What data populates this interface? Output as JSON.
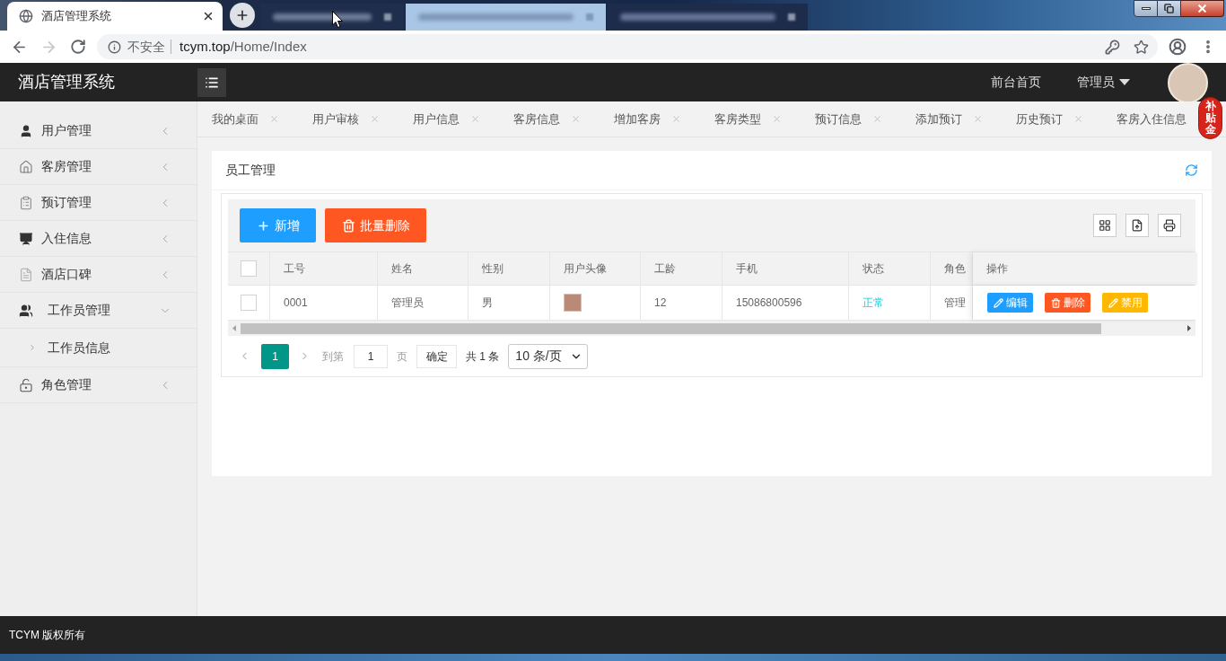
{
  "browser": {
    "tab_title": "酒店管理系统",
    "security_label": "不安全",
    "url_host": "tcym.top",
    "url_path": "/Home/Index"
  },
  "header": {
    "title": "酒店管理系统",
    "links": [
      {
        "label": "前台首页",
        "dropdown": false
      },
      {
        "label": "管理员",
        "dropdown": true
      }
    ]
  },
  "sidebar": {
    "items": [
      {
        "label": "用户管理",
        "expanded": false
      },
      {
        "label": "客房管理",
        "expanded": false
      },
      {
        "label": "预订管理",
        "expanded": false
      },
      {
        "label": "入住信息",
        "expanded": false
      },
      {
        "label": "酒店口碑",
        "expanded": false
      },
      {
        "label": "工作员管理",
        "expanded": true,
        "children": [
          {
            "label": "工作员信息"
          }
        ]
      },
      {
        "label": "角色管理",
        "expanded": false
      }
    ]
  },
  "page_tabs": [
    {
      "label": "我的桌面",
      "closable": true
    },
    {
      "label": "用户审核",
      "closable": true
    },
    {
      "label": "用户信息",
      "closable": true
    },
    {
      "label": "客房信息",
      "closable": true
    },
    {
      "label": "增加客房",
      "closable": true
    },
    {
      "label": "客房类型",
      "closable": true
    },
    {
      "label": "预订信息",
      "closable": true
    },
    {
      "label": "添加预订",
      "closable": true
    },
    {
      "label": "历史预订",
      "closable": true
    },
    {
      "label": "客房入住信息",
      "closable": false
    }
  ],
  "card": {
    "title": "员工管理",
    "toolbar": {
      "buttons": [
        {
          "label": "新增",
          "kind": "add"
        },
        {
          "label": "批量删除",
          "kind": "batch_delete"
        }
      ]
    },
    "table": {
      "select_all_checked": false,
      "columns": [
        "工号",
        "姓名",
        "性别",
        "用户头像",
        "工龄",
        "手机",
        "状态",
        "角色",
        "操作"
      ],
      "rows": [
        {
          "checked": false,
          "cells": [
            {
              "kind": "text",
              "value": "0001"
            },
            {
              "kind": "text",
              "value": "管理员"
            },
            {
              "kind": "text",
              "value": "男"
            },
            {
              "kind": "avatar"
            },
            {
              "kind": "text",
              "value": "12"
            },
            {
              "kind": "text",
              "value": "15086800596"
            },
            {
              "kind": "status",
              "value": "正常"
            },
            {
              "kind": "text",
              "value": "管理"
            }
          ],
          "actions": [
            {
              "label": "编辑",
              "kind": "edit"
            },
            {
              "label": "删除",
              "kind": "delete"
            },
            {
              "label": "禁用",
              "kind": "disable"
            }
          ]
        }
      ]
    },
    "pagination": {
      "pages": [
        {
          "label": "1",
          "selected": true
        }
      ],
      "goto_label": "到第",
      "goto_value": "1",
      "page_label": "页",
      "confirm": "确定",
      "total": "共 1 条",
      "page_size": "10 条/页"
    }
  },
  "footer": {
    "text": "TCYM 版权所有"
  },
  "overlay_badge": {
    "text": "补贴金"
  }
}
